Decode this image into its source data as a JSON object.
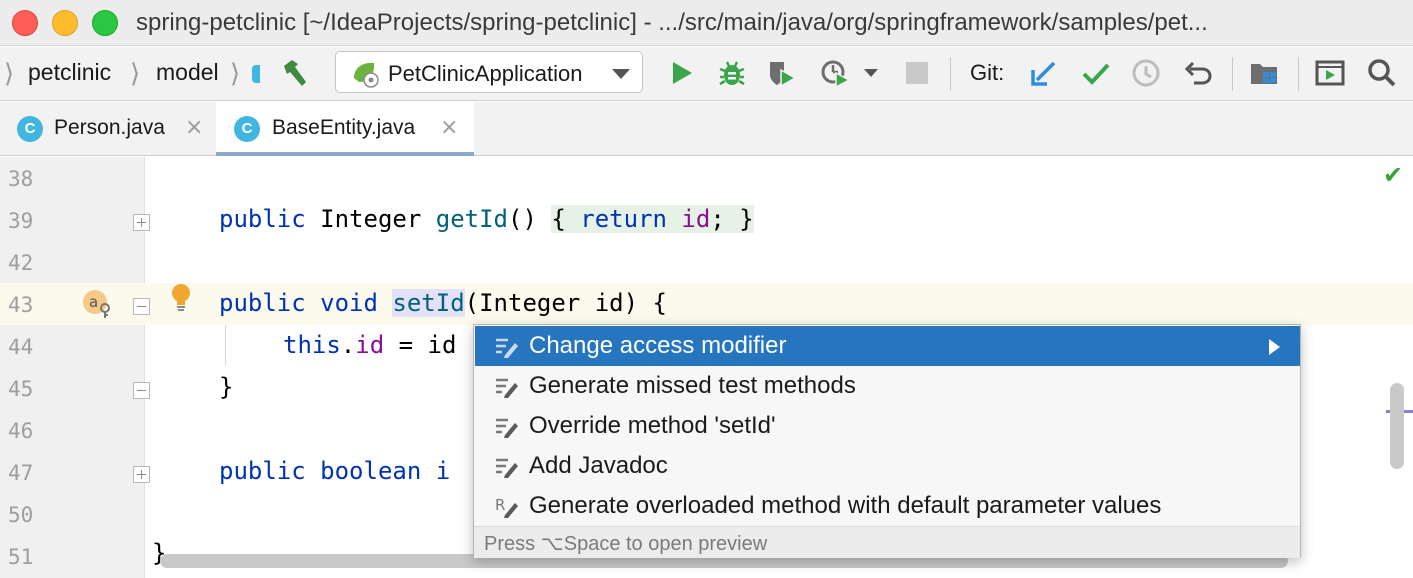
{
  "window": {
    "title": "spring-petclinic [~/IdeaProjects/spring-petclinic] - .../src/main/java/org/springframework/samples/pet..."
  },
  "breadcrumbs": [
    "petclinic",
    "model"
  ],
  "toolbar": {
    "run_config": "PetClinicApplication",
    "git_label": "Git:",
    "icons": [
      "build-hammer-icon",
      "run-icon",
      "debug-icon",
      "coverage-icon",
      "profile-icon",
      "stop-icon",
      "git-update-icon",
      "git-commit-icon",
      "git-history-icon",
      "git-rollback-icon",
      "project-structure-icon",
      "presentation-icon",
      "search-icon"
    ]
  },
  "tabs": [
    {
      "icon": "C",
      "label": "Person.java",
      "active": false
    },
    {
      "icon": "C",
      "label": "BaseEntity.java",
      "active": true
    }
  ],
  "editor": {
    "line_numbers": [
      "38",
      "39",
      "42",
      "43",
      "44",
      "45",
      "46",
      "47",
      "50",
      "51"
    ],
    "code": {
      "l39_kw": "public",
      "l39_type": " Integer ",
      "l39_fn": "getId",
      "l39_paren": "() ",
      "l39_brace_open": "{ ",
      "l39_return": "return",
      "l39_sp": " ",
      "l39_id": "id",
      "l39_semi": "; ",
      "l39_brace_close": "}",
      "l43_public": "public",
      "l43_void": " void ",
      "l43_fn": "setId",
      "l43_rest": "(Integer id) {",
      "l44_this": "this",
      "l44_dot": ".",
      "l44_id": "id",
      "l44_rest": " = id",
      "l45_brace": "}",
      "l47_kw": "public boolean",
      "l47_rest": " i",
      "l51_brace": "}"
    }
  },
  "intention_popup": {
    "items": [
      {
        "label": "Change access modifier",
        "selected": true,
        "has_submenu": true
      },
      {
        "label": "Generate missed test methods",
        "selected": false
      },
      {
        "label": "Override method 'setId'",
        "selected": false
      },
      {
        "label": "Add Javadoc",
        "selected": false
      },
      {
        "label": "Generate overloaded method with default parameter values",
        "selected": false
      }
    ],
    "footer": "Press ⌥Space to open preview"
  },
  "colors": {
    "selection": "#2675bf",
    "keyword": "#0033b3",
    "method": "#00627a",
    "field": "#871094"
  }
}
